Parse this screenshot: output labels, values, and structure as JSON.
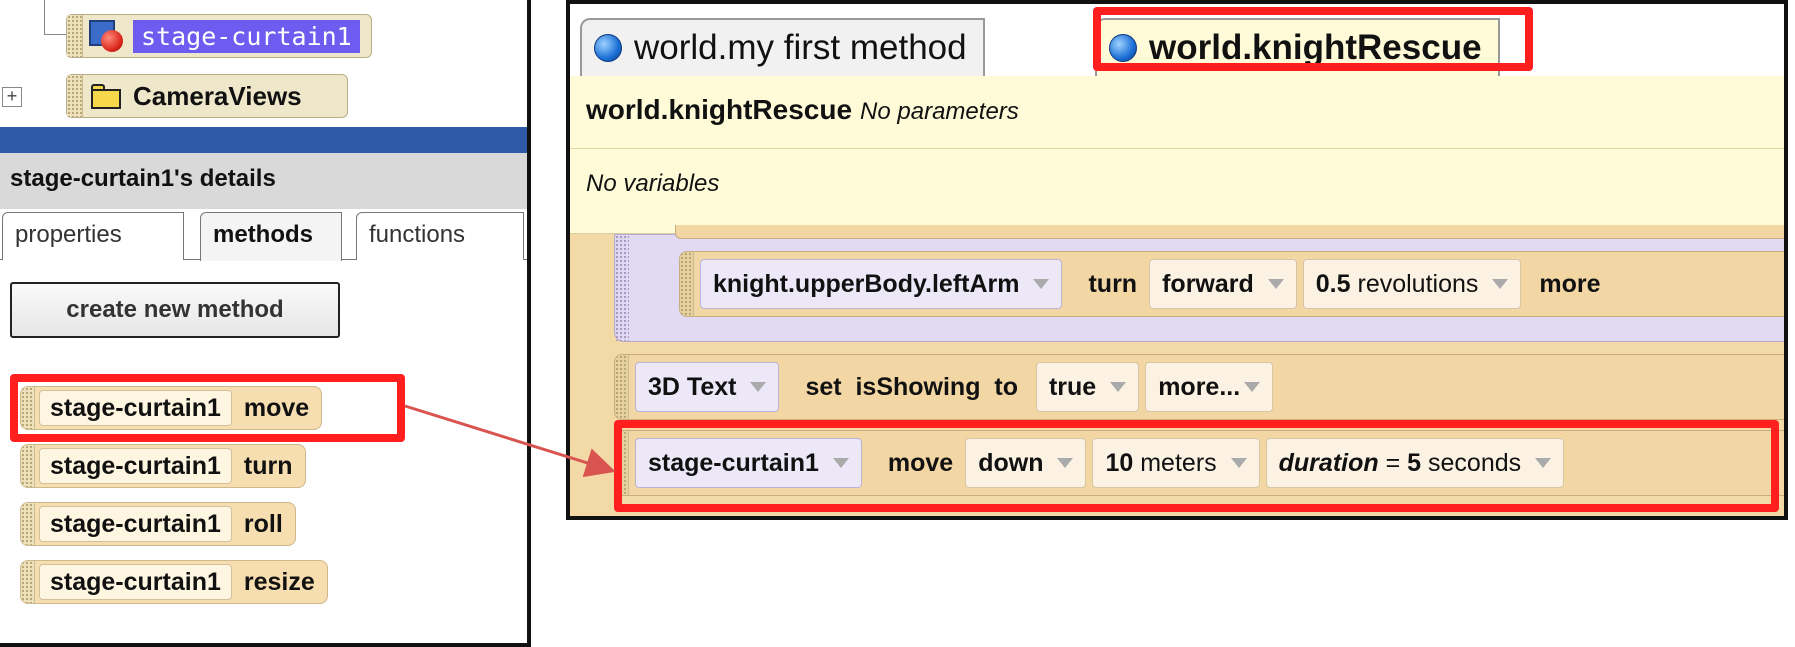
{
  "left_panel": {
    "tree": {
      "items": [
        {
          "label": "stage-curtain1",
          "icon": "object-icon",
          "selected": true
        },
        {
          "label": "CameraViews",
          "icon": "folder-icon",
          "expand": "+"
        }
      ]
    },
    "details_header": "stage-curtain1's details",
    "tabs": [
      {
        "label": "properties",
        "active": false
      },
      {
        "label": "methods",
        "active": true
      },
      {
        "label": "functions",
        "active": false
      }
    ],
    "create_method_label": "create new method",
    "methods": [
      {
        "object": "stage-curtain1",
        "name": "move",
        "highlighted": true
      },
      {
        "object": "stage-curtain1",
        "name": "turn"
      },
      {
        "object": "stage-curtain1",
        "name": "roll"
      },
      {
        "object": "stage-curtain1",
        "name": "resize"
      }
    ]
  },
  "editor": {
    "tabs": [
      {
        "label": "world.my first method",
        "active": false
      },
      {
        "label": "world.knightRescue",
        "active": true,
        "highlighted": true
      }
    ],
    "method_name": "world.knightRescue",
    "parameters_text": "No parameters",
    "variables_text": "No variables",
    "statements": [
      {
        "object": "knight.upperBody.leftArm",
        "verb": "turn",
        "direction": "forward",
        "amount_value": "0.5",
        "amount_unit": "revolutions",
        "more": "more"
      },
      {
        "object": "3D Text",
        "action": "set  isShowing  to",
        "value": "true",
        "more": "more..."
      },
      {
        "object": "stage-curtain1",
        "verb": "move",
        "direction": "down",
        "amount_value": "10",
        "amount_unit": "meters",
        "duration_key": "duration",
        "duration_eq": "=",
        "duration_value": "5",
        "duration_unit": "seconds",
        "highlighted": true
      }
    ]
  },
  "colors": {
    "highlight": "#ff1f1f",
    "selection": "#6e5cf0",
    "header_bar": "#2f5aa8",
    "method_bg": "#fffbd9",
    "code_bg": "#f2d9a6",
    "arrow": "#d9534f"
  }
}
